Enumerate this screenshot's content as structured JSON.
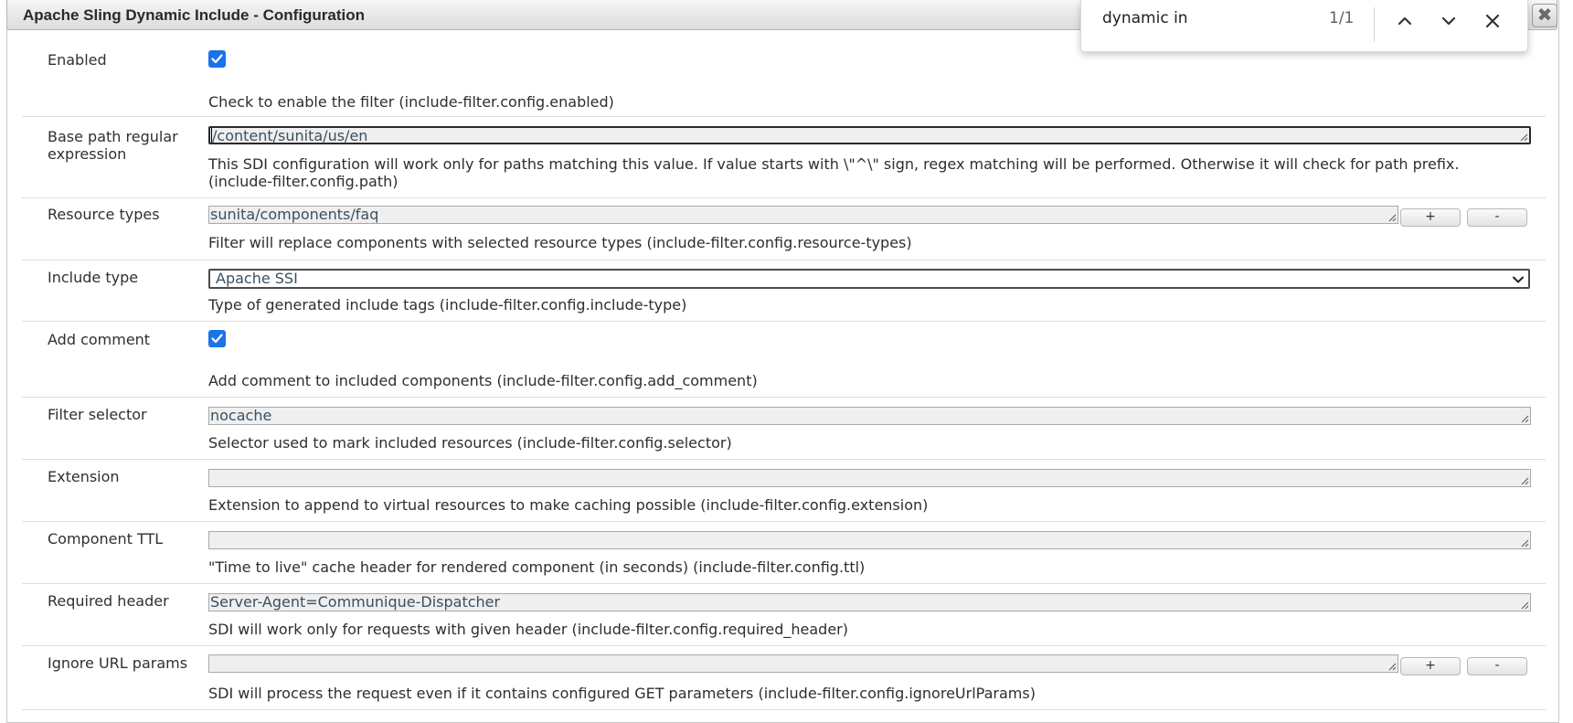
{
  "dialog": {
    "title": "Apache Sling Dynamic Include - Configuration",
    "close_glyph": "✖"
  },
  "find_bar": {
    "query": "dynamic in",
    "count": "1/1",
    "icons": [
      "chevron-up-icon",
      "chevron-down-icon",
      "close-icon"
    ]
  },
  "fields": {
    "enabled": {
      "label": "Enabled",
      "checked": true,
      "description": "Check to enable the filter (include-filter.config.enabled)"
    },
    "base_path": {
      "label": "Base path regular expression",
      "value_prefix": "/content/",
      "value_misspelled": "sunita",
      "value_suffix": "/us/en",
      "description_line1": "This SDI configuration will work only for paths matching this value. If value starts with \\\"^\\\" sign, regex matching will be performed. Otherwise it will check for path prefix.",
      "description_line2": "(include-filter.config.path)"
    },
    "resource_types": {
      "label": "Resource types",
      "value_part1": "sunita",
      "value_part2": "/components/",
      "value_part3": "faq",
      "add_button": "+",
      "remove_button": "-",
      "description": "Filter will replace components with selected resource types (include-filter.config.resource-types)"
    },
    "include_type": {
      "label": "Include type",
      "selected": "Apache SSI",
      "description": "Type of generated include tags (include-filter.config.include-type)"
    },
    "add_comment": {
      "label": "Add comment",
      "checked": true,
      "description": "Add comment to included components (include-filter.config.add_comment)"
    },
    "filter_selector": {
      "label": "Filter selector",
      "value": "nocache",
      "description": "Selector used to mark included resources (include-filter.config.selector)"
    },
    "extension": {
      "label": "Extension",
      "value": "",
      "description": "Extension to append to virtual resources to make caching possible (include-filter.config.extension)"
    },
    "component_ttl": {
      "label": "Component TTL",
      "value": "",
      "description": "\"Time to live\" cache header for rendered component (in seconds) (include-filter.config.ttl)"
    },
    "required_header": {
      "label": "Required header",
      "value": "Server-Agent=Communique-Dispatcher",
      "description": "SDI will work only for requests with given header (include-filter.config.required_header)"
    },
    "ignore_url_params": {
      "label": "Ignore URL params",
      "value": "",
      "add_button": "+",
      "remove_button": "-",
      "description": "SDI will process the request even if it contains configured GET parameters (include-filter.config.ignoreUrlParams)"
    }
  },
  "colors": {
    "checkbox": "#1a73e8",
    "field_bg": "#efefef",
    "row_divider": "#dedede"
  }
}
